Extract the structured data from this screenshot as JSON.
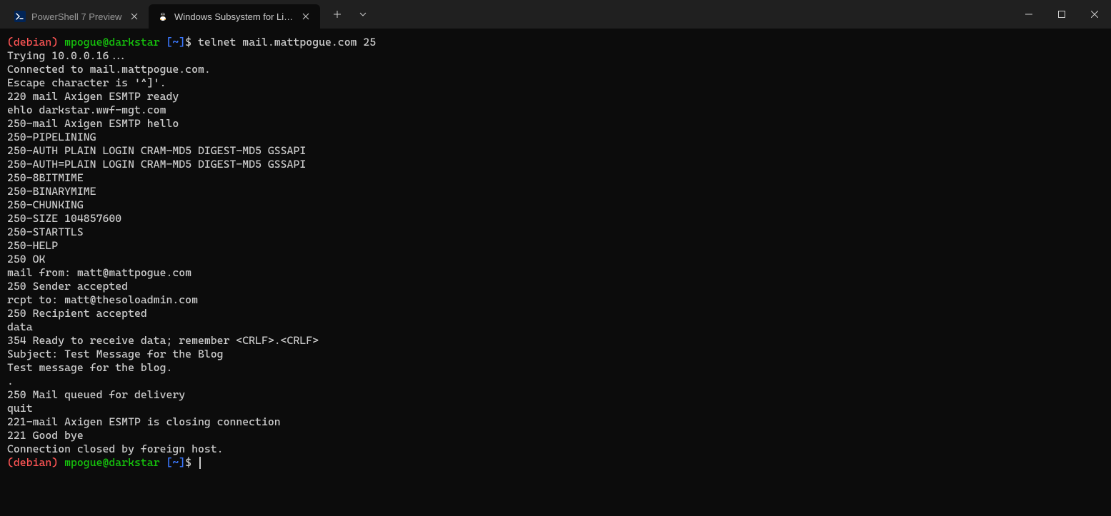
{
  "tabs": [
    {
      "title": "PowerShell 7 Preview",
      "active": false,
      "icon": "powershell"
    },
    {
      "title": "Windows Subsystem for Linux P",
      "active": true,
      "icon": "tux"
    }
  ],
  "prompts": [
    {
      "distro": "(debian)",
      "user": "mpogue@darkstar",
      "path": "[~]",
      "dollar": "$",
      "command": "telnet mail.mattpogue.com 25"
    },
    {
      "distro": "(debian)",
      "user": "mpogue@darkstar",
      "path": "[~]",
      "dollar": "$",
      "command": ""
    }
  ],
  "output_lines": [
    "Trying 10.0.0.16...",
    "Connected to mail.mattpogue.com.",
    "Escape character is '^]'.",
    "220 mail Axigen ESMTP ready",
    "ehlo darkstar.wwf-mgt.com",
    "250-mail Axigen ESMTP hello",
    "250-PIPELINING",
    "250-AUTH PLAIN LOGIN CRAM-MD5 DIGEST-MD5 GSSAPI",
    "250-AUTH=PLAIN LOGIN CRAM-MD5 DIGEST-MD5 GSSAPI",
    "250-8BITMIME",
    "250-BINARYMIME",
    "250-CHUNKING",
    "250-SIZE 104857600",
    "250-STARTTLS",
    "250-HELP",
    "250 OK",
    "mail from: matt@mattpogue.com",
    "250 Sender accepted",
    "rcpt to: matt@thesoloadmin.com",
    "250 Recipient accepted",
    "data",
    "354 Ready to receive data; remember <CRLF>.<CRLF>",
    "Subject: Test Message for the Blog",
    "Test message for the blog.",
    ".",
    "250 Mail queued for delivery",
    "quit",
    "221-mail Axigen ESMTP is closing connection",
    "221 Good bye",
    "Connection closed by foreign host."
  ]
}
